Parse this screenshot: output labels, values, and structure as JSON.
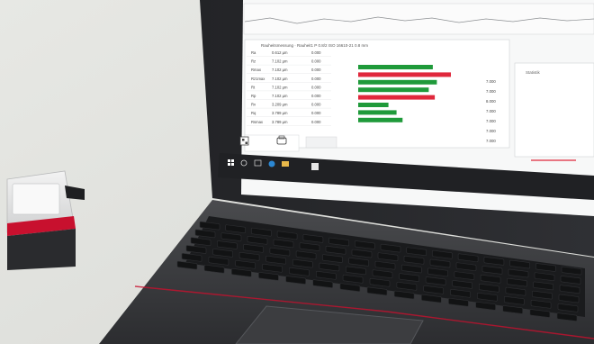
{
  "screen": {
    "app_title": "Rauheitsmessung · Rauheit1 P 0.8/2 ISO 16610-21 0.8 mm",
    "parameters": [
      {
        "name": "Ra",
        "value": "0.612 µm",
        "tol": "0.000"
      },
      {
        "name": "Rz",
        "value": "7.102 µm",
        "tol": "0.000"
      },
      {
        "name": "Rmax",
        "value": "7.102 µm",
        "tol": "0.000"
      },
      {
        "name": "Rz1max",
        "value": "7.102 µm",
        "tol": "0.000"
      },
      {
        "name": "Rt",
        "value": "7.102 µm",
        "tol": "0.000"
      },
      {
        "name": "Rp",
        "value": "7.102 µm",
        "tol": "0.000"
      },
      {
        "name": "Rv",
        "value": "3.209 µm",
        "tol": "0.000"
      },
      {
        "name": "Rq",
        "value": "3.789 µm",
        "tol": "0.000"
      },
      {
        "name": "Rsmax",
        "value": "3.789 µm",
        "tol": "0.000"
      }
    ],
    "limits": [
      "7.000",
      "7.000",
      "8.000",
      "7.000",
      "7.000",
      "7.000",
      "7.000"
    ],
    "bars": [
      {
        "value": 0.74,
        "status": "ok"
      },
      {
        "value": 0.92,
        "status": "fail"
      },
      {
        "value": 0.78,
        "status": "ok"
      },
      {
        "value": 0.7,
        "status": "ok"
      },
      {
        "value": 0.76,
        "status": "fail"
      },
      {
        "value": 0.3,
        "status": "ok"
      },
      {
        "value": 0.38,
        "status": "ok"
      },
      {
        "value": 0.44,
        "status": "ok"
      }
    ],
    "side_panel_title": "Statistik",
    "taskbar_icons": [
      "windows-icon",
      "search-icon",
      "task-view-icon",
      "edge-icon",
      "folder-icon",
      "app-icon"
    ]
  },
  "colors": {
    "ok": "#1f9a3a",
    "fail": "#e0283c",
    "screen_bg": "#f7f8f8",
    "laptop_body": "#3a3b3d",
    "accent_red": "#c8102e"
  }
}
